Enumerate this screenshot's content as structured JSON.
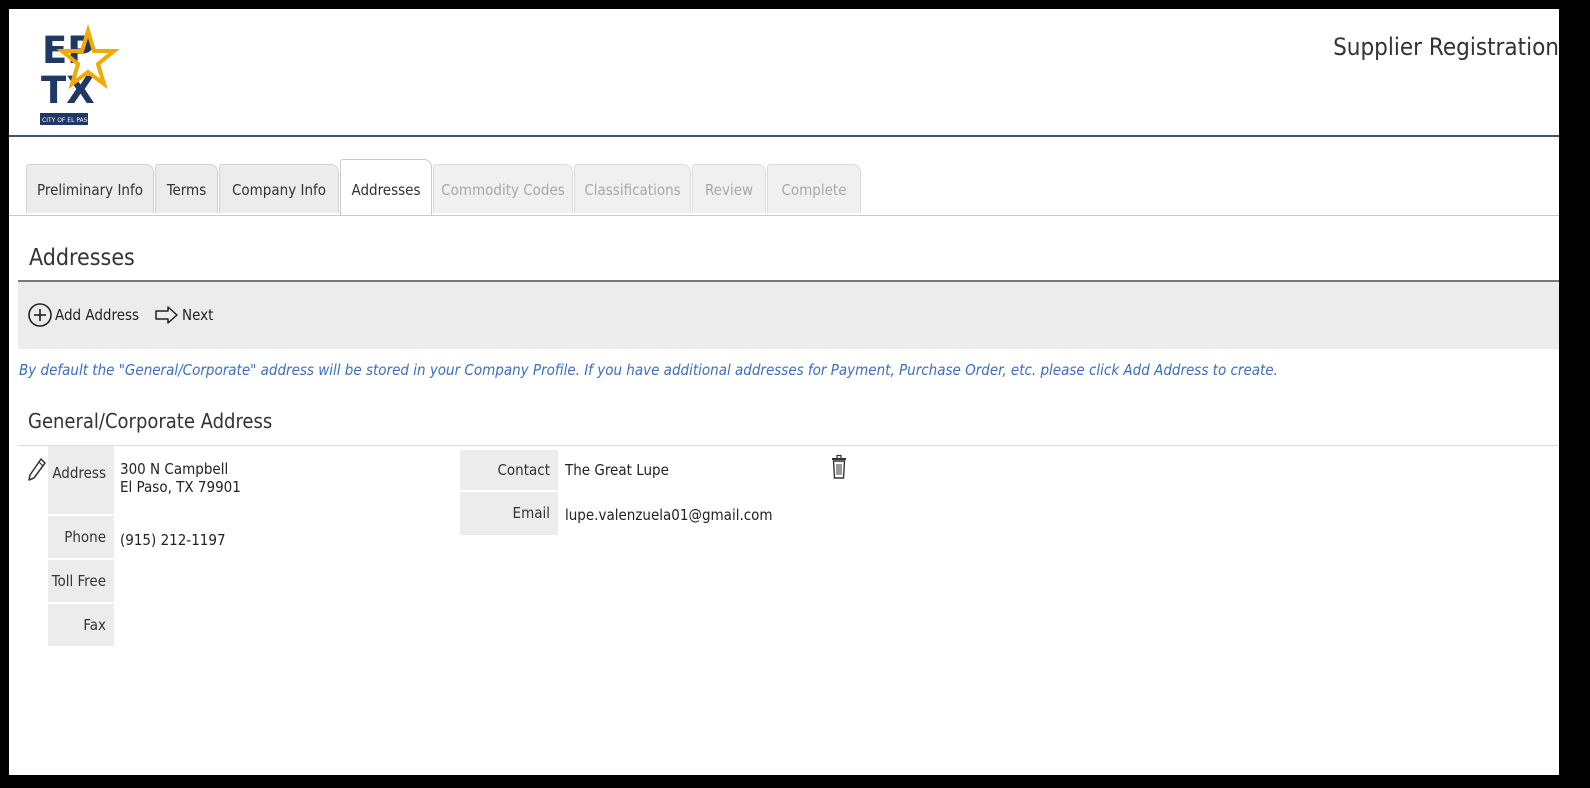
{
  "header": {
    "logo_text_line1": "EP",
    "logo_text_line2": "TX",
    "logo_caption": "CITY OF EL PASO",
    "app_title": "Supplier Registration"
  },
  "tabs": [
    {
      "label": "Preliminary Info",
      "state": "enabled"
    },
    {
      "label": "Terms",
      "state": "enabled"
    },
    {
      "label": "Company Info",
      "state": "enabled"
    },
    {
      "label": "Addresses",
      "state": "active"
    },
    {
      "label": "Commodity Codes",
      "state": "disabled"
    },
    {
      "label": "Classifications",
      "state": "disabled"
    },
    {
      "label": "Review",
      "state": "disabled"
    },
    {
      "label": "Complete",
      "state": "disabled"
    }
  ],
  "section": {
    "title": "Addresses",
    "toolbar": {
      "add_address_label": "Add Address",
      "next_label": "Next",
      "add_icon": "plus-circle-icon",
      "next_icon": "arrow-right-icon"
    },
    "info_text": "By default the \"General/Corporate\" address will be stored in your Company Profile. If you have additional addresses for Payment, Purchase Order, etc. please click Add Address to create."
  },
  "address_card": {
    "title": "General/Corporate Address",
    "edit_icon": "pencil-icon",
    "delete_icon": "trash-icon",
    "labels": {
      "address": "Address",
      "phone": "Phone",
      "toll_free": "Toll Free",
      "fax": "Fax",
      "contact_name": "Contact Name",
      "email": "Email"
    },
    "values": {
      "address_line1": "300 N Campbell",
      "address_line2": "El Paso, TX 79901",
      "phone": "(915) 212-1197",
      "toll_free": "",
      "fax": "",
      "contact_name": "The Great Lupe",
      "email": "lupe.valenzuela01@gmail.com"
    }
  },
  "colors": {
    "brand_navy": "#1f3864",
    "brand_gold": "#f2a900",
    "info_blue": "#3a6fbf",
    "header_rule": "#3f5574"
  }
}
